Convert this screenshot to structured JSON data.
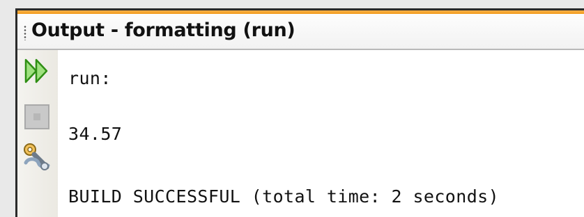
{
  "panel": {
    "title": "Output - formatting (run)"
  },
  "toolbar": {
    "rerun_icon": "rerun-icon",
    "stop_icon": "stop-icon",
    "settings_icon": "settings-icon"
  },
  "console": {
    "lines": [
      "run:",
      "34.57",
      "BUILD SUCCESSFUL (total time: 2 seconds)"
    ]
  },
  "colors": {
    "accent_orange": "#f39a1a",
    "rerun_green": "#3aa61c"
  }
}
